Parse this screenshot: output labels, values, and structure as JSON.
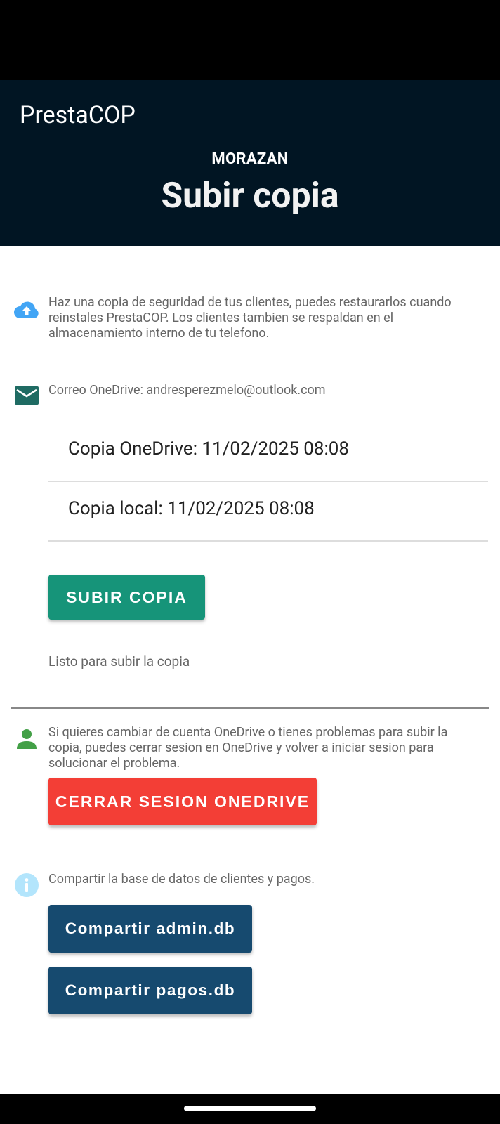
{
  "app": {
    "title": "PrestaCOP",
    "branch": "MORAZAN",
    "page_title": "Subir copia"
  },
  "backup_info": {
    "icon": "cloud-upload-icon",
    "text": "Haz una copia de seguridad de tus clientes, puedes restaurarlos cuando reinstales PrestaCOP. Los clientes tambien se respaldan en el almacenamiento interno de tu telefono."
  },
  "email": {
    "icon": "mail-icon",
    "text": "Correo OneDrive: andresperezmelo@outlook.com"
  },
  "copies": {
    "onedrive": "Copia OneDrive:  11/02/2025 08:08",
    "local": "Copia local:  11/02/2025 08:08"
  },
  "upload_button": "SUBIR COPIA",
  "status": "Listo para subir la copia",
  "account_info": {
    "icon": "person-icon",
    "text": "Si quieres cambiar de cuenta OneDrive o tienes problemas para subir la copia, puedes cerrar sesion en OneDrive y volver a iniciar sesion para solucionar el problema."
  },
  "logout_button": "CERRAR SESION ONEDRIVE",
  "share_info": {
    "icon": "info-icon",
    "text": "Compartir la base de datos de clientes y pagos."
  },
  "share_admin_button": "Compartir admin.db",
  "share_pagos_button": "Compartir pagos.db",
  "colors": {
    "header_bg": "#011523",
    "upload_button": "#169479",
    "logout_button": "#f33e36",
    "share_button": "#164a6f",
    "cloud_icon": "#42a5f5",
    "mail_icon": "#1f6b63",
    "person_icon": "#43a047",
    "info_icon": "#b3e5fc"
  }
}
